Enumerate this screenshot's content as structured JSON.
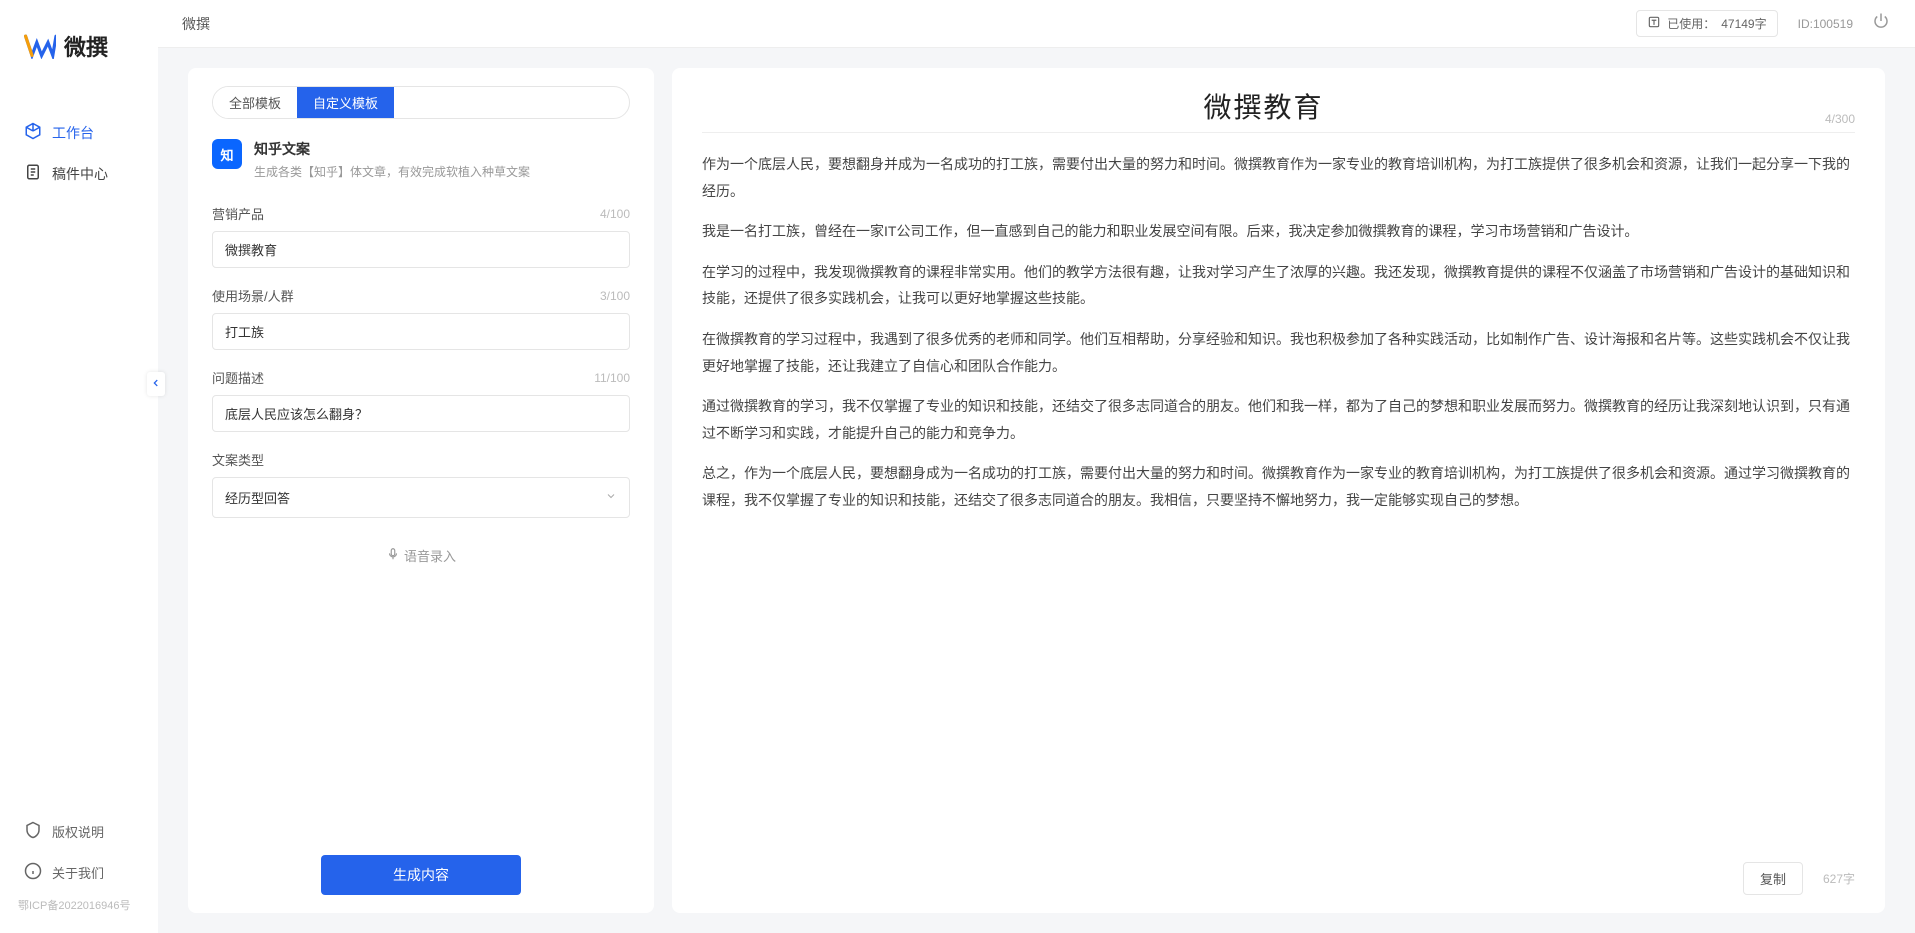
{
  "app": {
    "logo_text": "微撰",
    "page_title": "微撰"
  },
  "topbar": {
    "usage_label": "已使用：",
    "usage_value": "47149字",
    "user_id": "ID:100519"
  },
  "sidebar": {
    "items": [
      {
        "label": "工作台",
        "icon": "cube-icon",
        "active": true
      },
      {
        "label": "稿件中心",
        "icon": "doc-icon",
        "active": false
      }
    ],
    "footer": [
      {
        "label": "版权说明",
        "icon": "shield-icon"
      },
      {
        "label": "关于我们",
        "icon": "info-icon"
      }
    ],
    "icp": "鄂ICP备2022016946号"
  },
  "tabs": {
    "all": "全部模板",
    "custom": "自定义模板"
  },
  "template": {
    "icon_text": "知",
    "name": "知乎文案",
    "desc": "生成各类【知乎】体文章，有效完成软植入种草文案"
  },
  "form": {
    "fields": [
      {
        "label": "营销产品",
        "value": "微撰教育",
        "count": "4/100"
      },
      {
        "label": "使用场景/人群",
        "value": "打工族",
        "count": "3/100"
      },
      {
        "label": "问题描述",
        "value": "底层人民应该怎么翻身？",
        "count": "11/100"
      }
    ],
    "type_label": "文案类型",
    "type_value": "经历型回答",
    "voice_label": "语音录入",
    "gen_label": "生成内容"
  },
  "output": {
    "title": "微撰教育",
    "title_count": "4/300",
    "paragraphs": [
      "作为一个底层人民，要想翻身并成为一名成功的打工族，需要付出大量的努力和时间。微撰教育作为一家专业的教育培训机构，为打工族提供了很多机会和资源，让我们一起分享一下我的经历。",
      "我是一名打工族，曾经在一家IT公司工作，但一直感到自己的能力和职业发展空间有限。后来，我决定参加微撰教育的课程，学习市场营销和广告设计。",
      "在学习的过程中，我发现微撰教育的课程非常实用。他们的教学方法很有趣，让我对学习产生了浓厚的兴趣。我还发现，微撰教育提供的课程不仅涵盖了市场营销和广告设计的基础知识和技能，还提供了很多实践机会，让我可以更好地掌握这些技能。",
      "在微撰教育的学习过程中，我遇到了很多优秀的老师和同学。他们互相帮助，分享经验和知识。我也积极参加了各种实践活动，比如制作广告、设计海报和名片等。这些实践机会不仅让我更好地掌握了技能，还让我建立了自信心和团队合作能力。",
      "通过微撰教育的学习，我不仅掌握了专业的知识和技能，还结交了很多志同道合的朋友。他们和我一样，都为了自己的梦想和职业发展而努力。微撰教育的经历让我深刻地认识到，只有通过不断学习和实践，才能提升自己的能力和竞争力。",
      "总之，作为一个底层人民，要想翻身成为一名成功的打工族，需要付出大量的努力和时间。微撰教育作为一家专业的教育培训机构，为打工族提供了很多机会和资源。通过学习微撰教育的课程，我不仅掌握了专业的知识和技能，还结交了很多志同道合的朋友。我相信，只要坚持不懈地努力，我一定能够实现自己的梦想。"
    ],
    "copy_label": "复制",
    "char_count": "627字"
  }
}
